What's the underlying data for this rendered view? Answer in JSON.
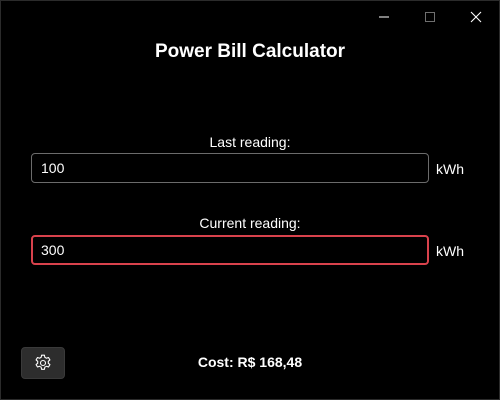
{
  "window": {
    "title": "Power Bill Calculator",
    "caption_icons": [
      "minimize-icon",
      "maximize-icon",
      "close-icon"
    ]
  },
  "last_reading": {
    "label": "Last reading:",
    "value": "100",
    "unit": "kWh"
  },
  "current_reading": {
    "label": "Current reading:",
    "value": "300",
    "unit": "kWh"
  },
  "footer": {
    "settings_icon": "gear-icon",
    "cost": "Cost: R$ 168,48"
  },
  "colors": {
    "background": "#000000",
    "focus_border": "#d9424c",
    "input_border": "#6b6b6b",
    "button_bg": "#2d2d2d"
  }
}
